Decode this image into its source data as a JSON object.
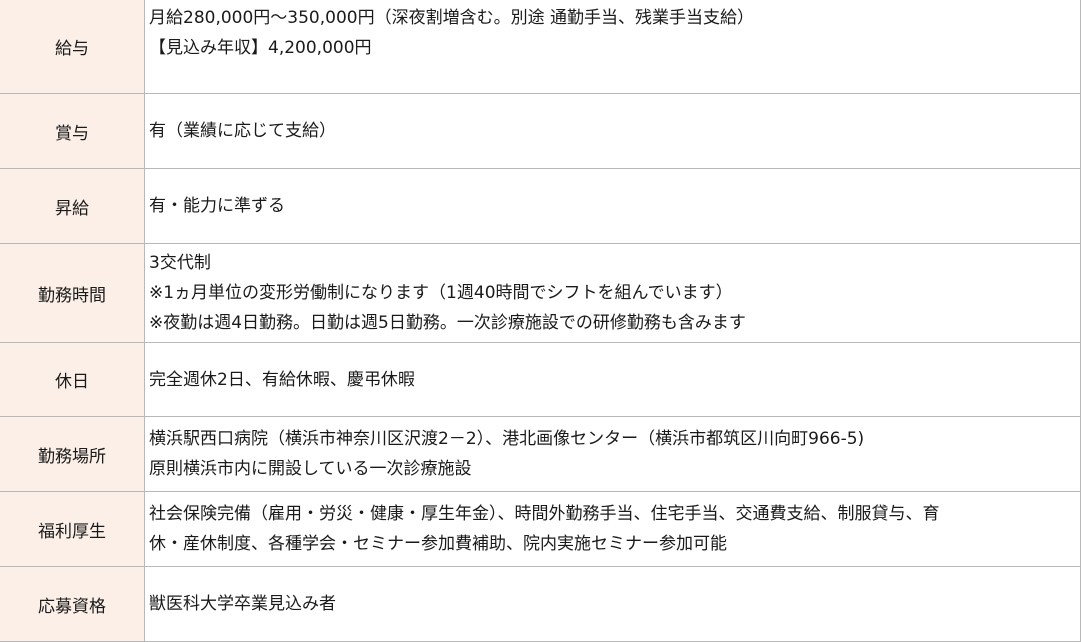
{
  "rows": [
    {
      "label": "給与",
      "lines": [
        "月給280,000円～350,000円（深夜割増含む。別途 通勤手当、残業手当支給）",
        "【見込み年収】4,200,000円"
      ]
    },
    {
      "label": "賞与",
      "lines": [
        "有（業績に応じて支給）"
      ]
    },
    {
      "label": "昇給",
      "lines": [
        "有・能力に準ずる"
      ]
    },
    {
      "label": "勤務時間",
      "lines": [
        "3交代制",
        "※1ヵ月単位の変形労働制になります（1週40時間でシフトを組んでいます）",
        "※夜勤は週4日勤務。日勤は週5日勤務。一次診療施設での研修勤務も含みます"
      ]
    },
    {
      "label": "休日",
      "lines": [
        "完全週休2日、有給休暇、慶弔休暇"
      ]
    },
    {
      "label": "勤務場所",
      "lines": [
        "横浜駅西口病院（横浜市神奈川区沢渡2－2）、港北画像センター（横浜市都筑区川向町966-5)",
        "原則横浜市内に開設している一次診療施設"
      ]
    },
    {
      "label": "福利厚生",
      "lines": [
        "社会保険完備（雇用・労災・健康・厚生年金）、時間外勤務手当、住宅手当、交通費支給、制服貸与、育",
        "休・産休制度、各種学会・セミナー参加費補助、院内実施セミナー参加可能"
      ]
    },
    {
      "label": "応募資格",
      "lines": [
        "獣医科大学卒業見込み者"
      ]
    }
  ]
}
